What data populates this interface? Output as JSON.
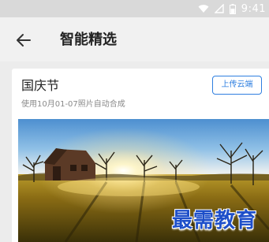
{
  "status_bar": {
    "time": "9:41",
    "icons": [
      "wifi-icon",
      "signal-icon",
      "battery-icon"
    ]
  },
  "header": {
    "back_icon": "arrow-left-icon",
    "title": "智能精选"
  },
  "album": {
    "title": "国庆节",
    "subtitle": "使用10月01-07照片自动合成",
    "upload_label": "上传云端",
    "cover_image": "sunset-farmhouse-photo"
  },
  "watermark": {
    "text": "最需教育"
  },
  "colors": {
    "accent": "#2f7fe0",
    "watermark": "#1e4fc9",
    "title_text": "#222222",
    "secondary_text": "#8a8a8a",
    "background": "#ececec"
  }
}
